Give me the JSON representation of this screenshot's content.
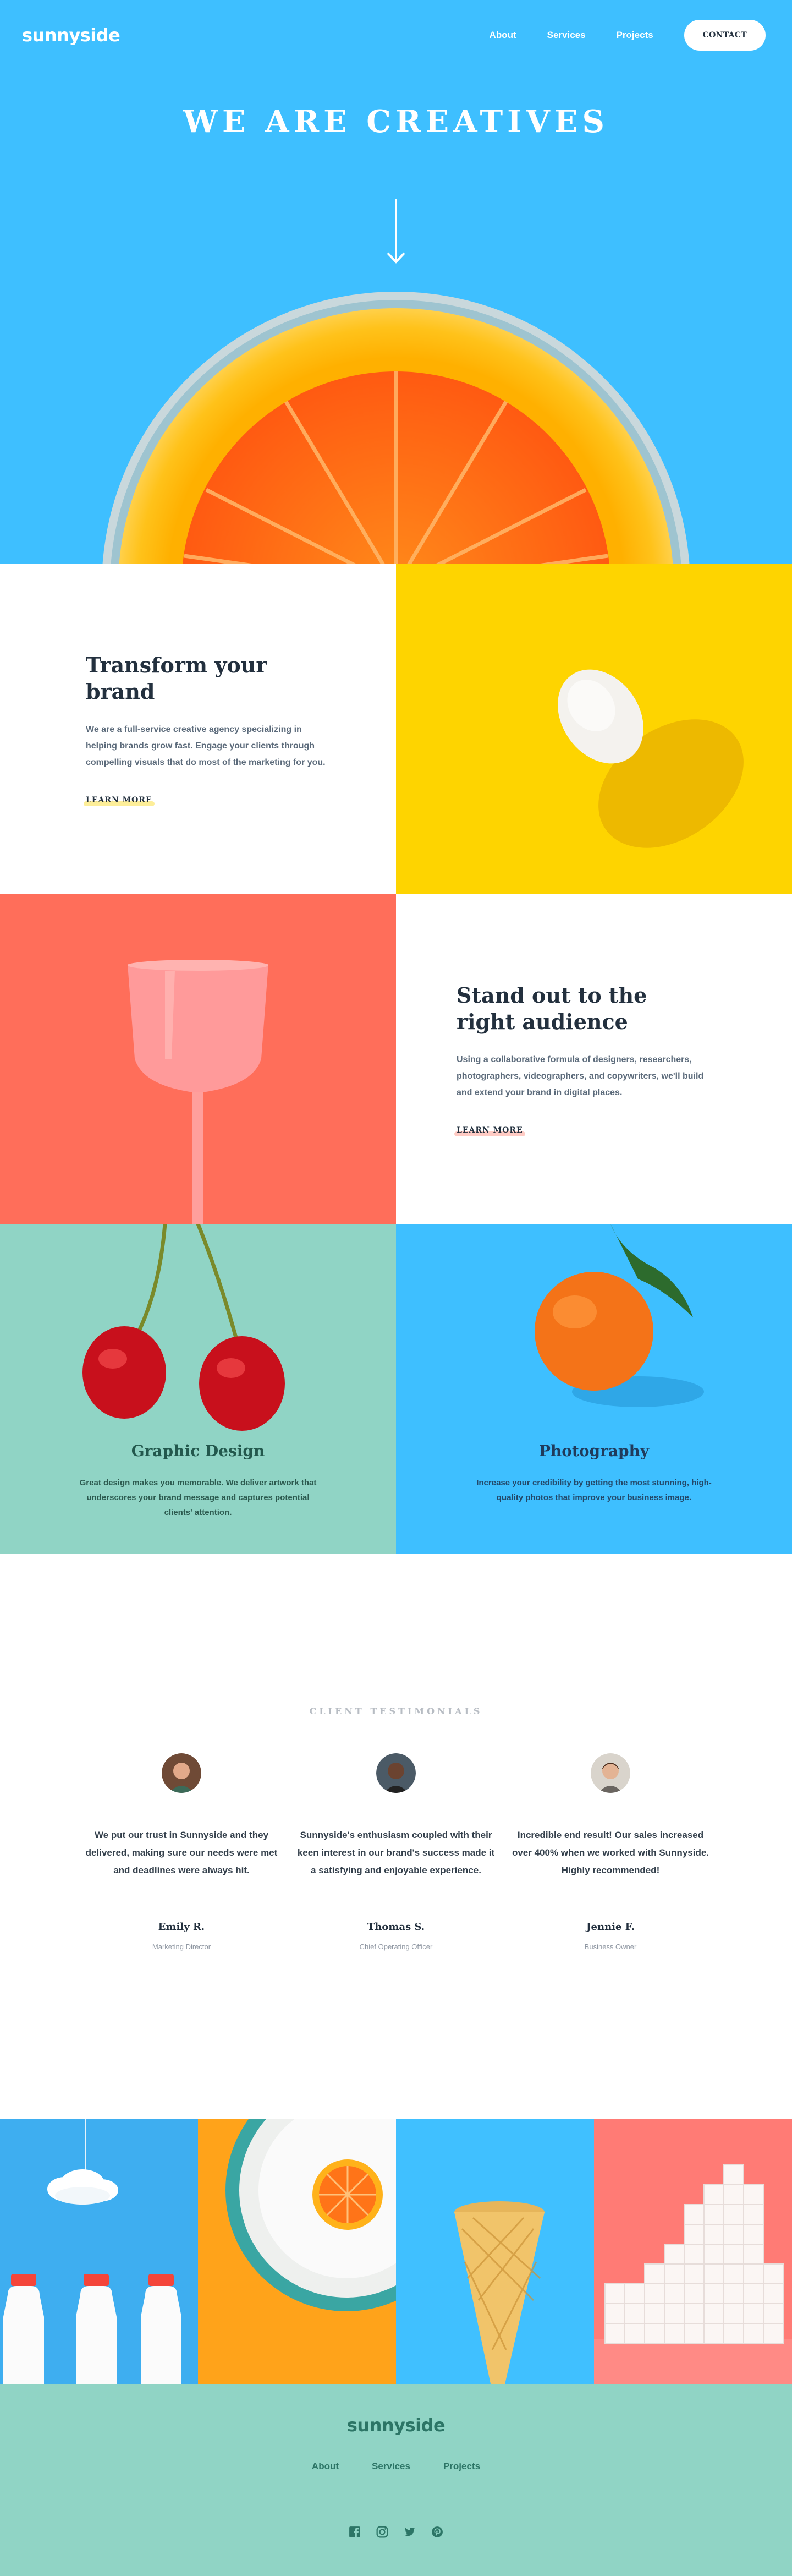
{
  "header": {
    "logo": "sunnyside",
    "nav": [
      {
        "label": "About"
      },
      {
        "label": "Services"
      },
      {
        "label": "Projects"
      }
    ],
    "contact_label": "CONTACT"
  },
  "hero": {
    "title": "WE ARE CREATIVES"
  },
  "sections": {
    "transform": {
      "title": "Transform your brand",
      "body": "We are a full-service creative agency specializing in helping brands grow fast. Engage your clients through compelling visuals that do most of the marketing for you.",
      "link": "LEARN MORE",
      "underline_color": "#fad400"
    },
    "standout": {
      "title": "Stand out to the right audience",
      "body": "Using a collaborative formula of designers, researchers, photographers, videographers, and copywriters, we'll build and extend your brand in digital places.",
      "link": "LEARN MORE",
      "underline_color": "#ff7e6b"
    }
  },
  "services": [
    {
      "title": "Graphic Design",
      "body": "Great design makes you memorable. We deliver artwork that underscores your brand message and captures potential clients' attention."
    },
    {
      "title": "Photography",
      "body": "Increase your credibility by getting the most stunning, high-quality photos that improve your business image."
    }
  ],
  "testimonials": {
    "label": "CLIENT TESTIMONIALS",
    "items": [
      {
        "quote": "We put our trust in Sunnyside and they delivered, making sure our needs were met and deadlines were always hit.",
        "name": "Emily R.",
        "role": "Marketing Director"
      },
      {
        "quote": "Sunnyside's enthusiasm coupled with their keen interest in our brand's success made it a satisfying and enjoyable experience.",
        "name": "Thomas S.",
        "role": "Chief Operating Officer"
      },
      {
        "quote": "Incredible end result! Our sales increased over 400% when we worked with Sunnyside. Highly recommended!",
        "name": "Jennie F.",
        "role": "Business Owner"
      }
    ]
  },
  "footer": {
    "logo": "sunnyside",
    "nav": [
      {
        "label": "About"
      },
      {
        "label": "Services"
      },
      {
        "label": "Projects"
      }
    ],
    "socials": [
      "facebook-icon",
      "instagram-icon",
      "twitter-icon",
      "pinterest-icon"
    ]
  },
  "colors": {
    "hero_blue": "#3ebfff",
    "yellow": "#fed400",
    "coral": "#ff6e5a",
    "mint": "#90d4c5",
    "dark": "#23303e",
    "footer_text": "#2c7566"
  }
}
